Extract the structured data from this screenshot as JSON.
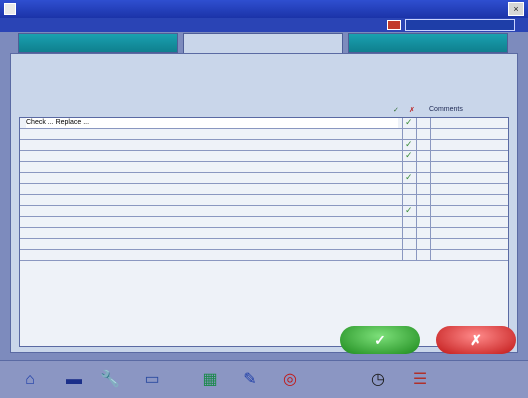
{
  "window": {
    "title": "",
    "status": ""
  },
  "infobar": {
    "text": ""
  },
  "tabs": [
    {
      "label": ""
    },
    {
      "label": ""
    },
    {
      "label": ""
    }
  ],
  "checklist": {
    "heading": "",
    "columns": {
      "check": "✓",
      "cross": "✗",
      "comments": "Comments"
    },
    "rows": [
      {
        "text": "Check ... Replace ...",
        "checked": true
      },
      {
        "text": "",
        "checked": false
      },
      {
        "text": "",
        "checked": true
      },
      {
        "text": "",
        "checked": true
      },
      {
        "text": "",
        "checked": false
      },
      {
        "text": "",
        "checked": true
      },
      {
        "text": "",
        "checked": false
      },
      {
        "text": "",
        "checked": false
      },
      {
        "text": "",
        "checked": true
      },
      {
        "text": "",
        "checked": false
      },
      {
        "text": "",
        "checked": false
      },
      {
        "text": "",
        "checked": false
      },
      {
        "text": "",
        "checked": false
      }
    ]
  },
  "buttons": {
    "ok_icon": "✓",
    "cancel_icon": "✗"
  },
  "toolbar": [
    {
      "icon": "home-icon",
      "glyph": "⌂"
    },
    {
      "icon": "truck-icon",
      "glyph": "▬"
    },
    {
      "icon": "wrench-icon",
      "glyph": "🔧"
    },
    {
      "icon": "tray-icon",
      "glyph": "▭"
    },
    {
      "icon": "clipboard-icon",
      "glyph": "▦"
    },
    {
      "icon": "pen-icon",
      "glyph": "✎"
    },
    {
      "icon": "tire-icon",
      "glyph": "◎"
    },
    {
      "icon": "clock-icon",
      "glyph": "◷"
    },
    {
      "icon": "list-icon",
      "glyph": "☰"
    }
  ],
  "colors": {
    "tab_inactive": "#1aa1b0",
    "panel": "#c9d6ea",
    "ok": "#1d8a1d",
    "cancel": "#c11818"
  }
}
